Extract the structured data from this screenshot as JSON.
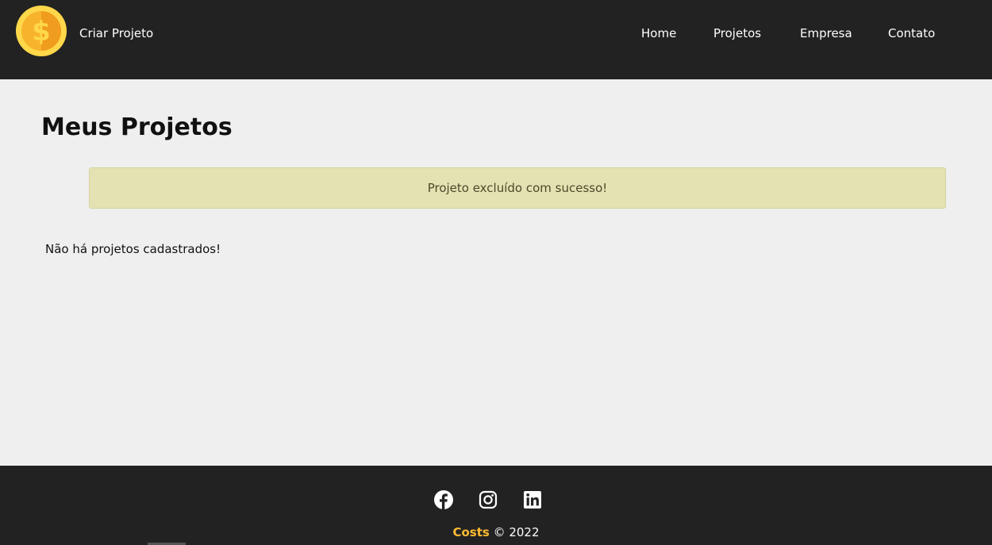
{
  "navbar": {
    "logo_icon": "dollar-coin-icon",
    "create_project_label": "Criar Projeto",
    "links": [
      {
        "label": "Home"
      },
      {
        "label": "Projetos"
      },
      {
        "label": "Empresa"
      },
      {
        "label": "Contato"
      }
    ]
  },
  "main": {
    "title": "Meus Projetos",
    "success_message": "Projeto excluído com sucesso!",
    "empty_text": "Não há projetos cadastrados!"
  },
  "footer": {
    "social_icons": [
      "facebook-icon",
      "instagram-icon",
      "linkedin-icon"
    ],
    "brand": "Costs",
    "copyright": "© 2022"
  },
  "colors": {
    "nav_background": "#222222",
    "page_background": "#efefef",
    "message_background": "#e4e2b2",
    "brand_accent": "#ffbb33"
  }
}
